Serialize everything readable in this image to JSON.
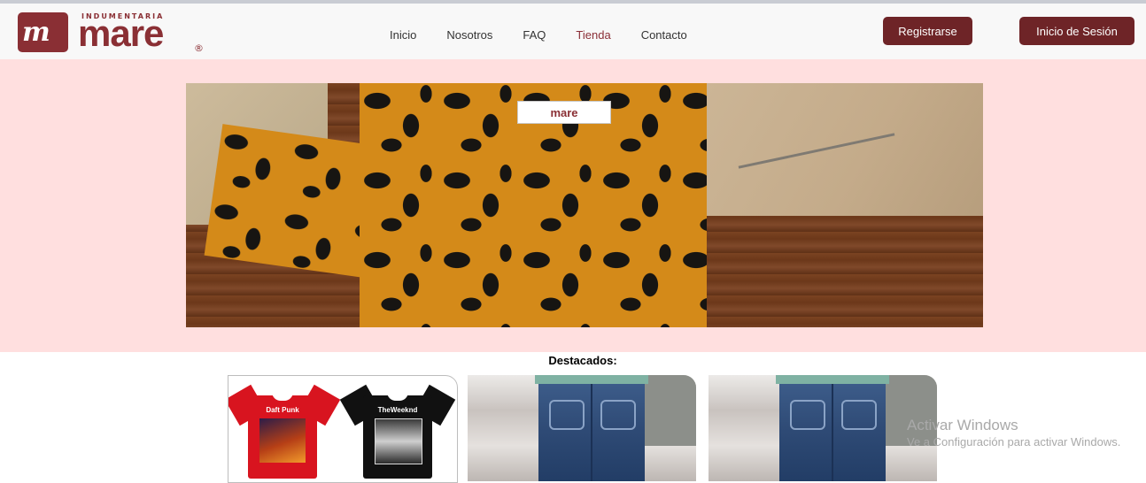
{
  "brand": {
    "monogram": "m",
    "tagline": "INDUMENTARIA",
    "name": "mare",
    "registered": "®"
  },
  "nav": {
    "items": [
      {
        "label": "Inicio"
      },
      {
        "label": "Nosotros"
      },
      {
        "label": "FAQ"
      },
      {
        "label": "Tienda",
        "active": true
      },
      {
        "label": "Contacto"
      }
    ]
  },
  "auth": {
    "register_label": "Registrarse",
    "login_label": "Inicio de Sesión"
  },
  "hero": {
    "tag_text": "mare"
  },
  "featured": {
    "title": "Destacados:",
    "products": [
      {
        "type": "t-shirts",
        "prints": [
          "Daft Punk",
          "TheWeeknd"
        ]
      },
      {
        "type": "jeans"
      },
      {
        "type": "jeans"
      }
    ]
  },
  "watermark": {
    "line1": "Activar Windows",
    "line2": "Ve a Configuración para activar Windows."
  },
  "colors": {
    "brand": "#8a2f34",
    "button": "#6e2427",
    "hero_band": "#ffdfdf",
    "active_nav": "#8b2f37"
  }
}
